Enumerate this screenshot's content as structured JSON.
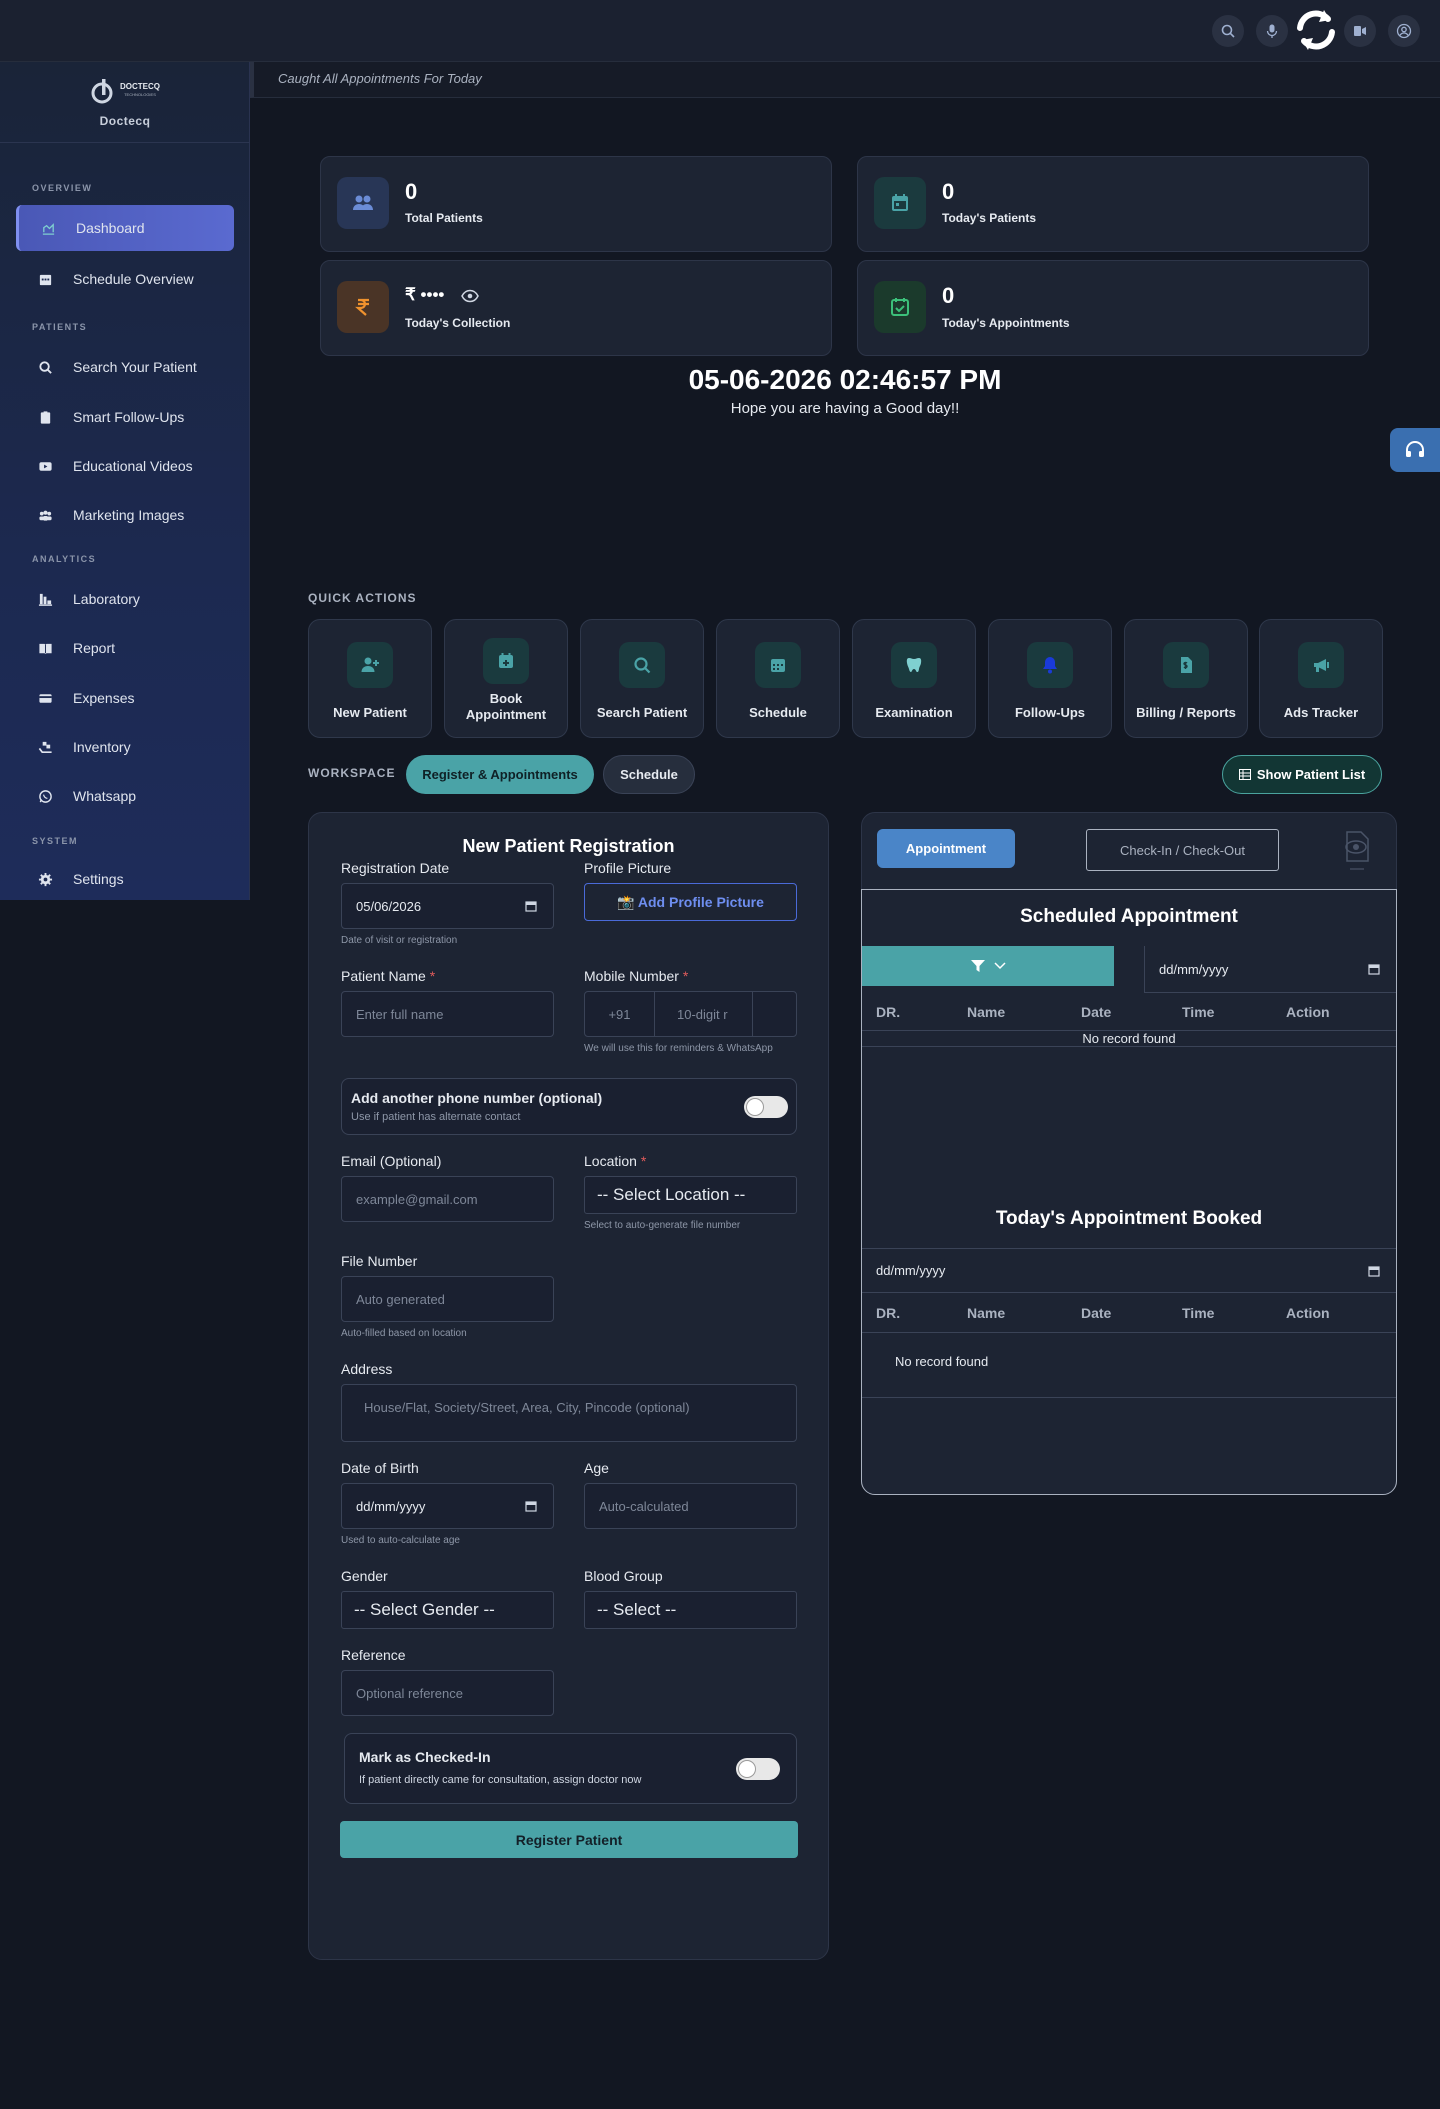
{
  "header": {
    "subtitle": "Caught All Appointments For Today"
  },
  "sidebar": {
    "brand": "Doctecq",
    "logo_text": "DOCTECQ",
    "logo_sub": "TECHNOLOGIES",
    "sections": {
      "overview": "OVERVIEW",
      "patients": "PATIENTS",
      "analytics": "ANALYTICS",
      "system": "SYSTEM"
    },
    "items": [
      {
        "label": "Dashboard",
        "icon": "dashboard-icon"
      },
      {
        "label": "Schedule Overview",
        "icon": "calendar-icon"
      },
      {
        "label": "Search Your Patient",
        "icon": "search-icon"
      },
      {
        "label": "Smart Follow-Ups",
        "icon": "clipboard-icon"
      },
      {
        "label": "Educational Videos",
        "icon": "youtube-icon"
      },
      {
        "label": "Marketing Images",
        "icon": "users-icon"
      },
      {
        "label": "Laboratory",
        "icon": "lab-icon"
      },
      {
        "label": "Report",
        "icon": "book-icon"
      },
      {
        "label": "Expenses",
        "icon": "card-icon"
      },
      {
        "label": "Inventory",
        "icon": "inventory-icon"
      },
      {
        "label": "Whatsapp",
        "icon": "whatsapp-icon"
      },
      {
        "label": "Settings",
        "icon": "gear-icon"
      }
    ]
  },
  "stats": [
    {
      "value": "0",
      "label": "Total Patients"
    },
    {
      "value": "0",
      "label": "Today's Patients"
    },
    {
      "value": "₹ ••••",
      "label": "Today's Collection"
    },
    {
      "value": "0",
      "label": "Today's Appointments"
    }
  ],
  "greeting": {
    "datetime": "05-06-2026 02:46:57 PM",
    "message": "Hope you are having a Good day!!"
  },
  "quick_actions": {
    "title": "QUICK ACTIONS",
    "items": [
      {
        "label": "New Patient"
      },
      {
        "label": "Book Appointment"
      },
      {
        "label": "Search Patient"
      },
      {
        "label": "Schedule"
      },
      {
        "label": "Examination"
      },
      {
        "label": "Follow-Ups"
      },
      {
        "label": "Billing / Reports"
      },
      {
        "label": "Ads Tracker"
      }
    ]
  },
  "workspace": {
    "label": "WORKSPACE",
    "tabs": [
      "Register & Appointments",
      "Schedule"
    ],
    "show_list": "Show Patient List"
  },
  "form": {
    "title": "New Patient Registration",
    "registration_date": {
      "label": "Registration Date",
      "value": "05/06/2026",
      "help": "Date of visit or registration"
    },
    "profile_picture": {
      "label": "Profile Picture",
      "button": "📸 Add Profile Picture"
    },
    "patient_name": {
      "label": "Patient Name",
      "placeholder": "Enter full name"
    },
    "mobile": {
      "label": "Mobile Number",
      "code": "+91",
      "placeholder": "10-digit r",
      "help": "We will use this for reminders & WhatsApp"
    },
    "alt_phone": {
      "title": "Add another phone number (optional)",
      "sub": "Use if patient has alternate contact"
    },
    "email": {
      "label": "Email (Optional)",
      "placeholder": "example@gmail.com"
    },
    "location": {
      "label": "Location",
      "value": "-- Select Location --",
      "help": "Select to auto-generate file number"
    },
    "file_number": {
      "label": "File Number",
      "placeholder": "Auto generated",
      "help": "Auto-filled based on location"
    },
    "address": {
      "label": "Address",
      "placeholder": "House/Flat, Society/Street, Area, City, Pincode (optional)"
    },
    "dob": {
      "label": "Date of Birth",
      "value": "dd/mm/yyyy",
      "help": "Used to auto-calculate age"
    },
    "age": {
      "label": "Age",
      "placeholder": "Auto-calculated"
    },
    "gender": {
      "label": "Gender",
      "value": "-- Select Gender --"
    },
    "blood_group": {
      "label": "Blood Group",
      "value": "-- Select --"
    },
    "reference": {
      "label": "Reference",
      "placeholder": "Optional reference"
    },
    "checked_in": {
      "title": "Mark as Checked-In",
      "sub": "If patient directly came for consultation, assign doctor now"
    },
    "submit": "Register Patient"
  },
  "appointments": {
    "tab_appointment": "Appointment",
    "tab_checkin": "Check-In / Check-Out",
    "scheduled_title": "Scheduled Appointment",
    "date_placeholder": "dd/mm/yyyy",
    "columns": [
      "DR.",
      "Name",
      "Date",
      "Time",
      "Action"
    ],
    "empty": "No record found",
    "today_title": "Today's Appointment Booked"
  }
}
